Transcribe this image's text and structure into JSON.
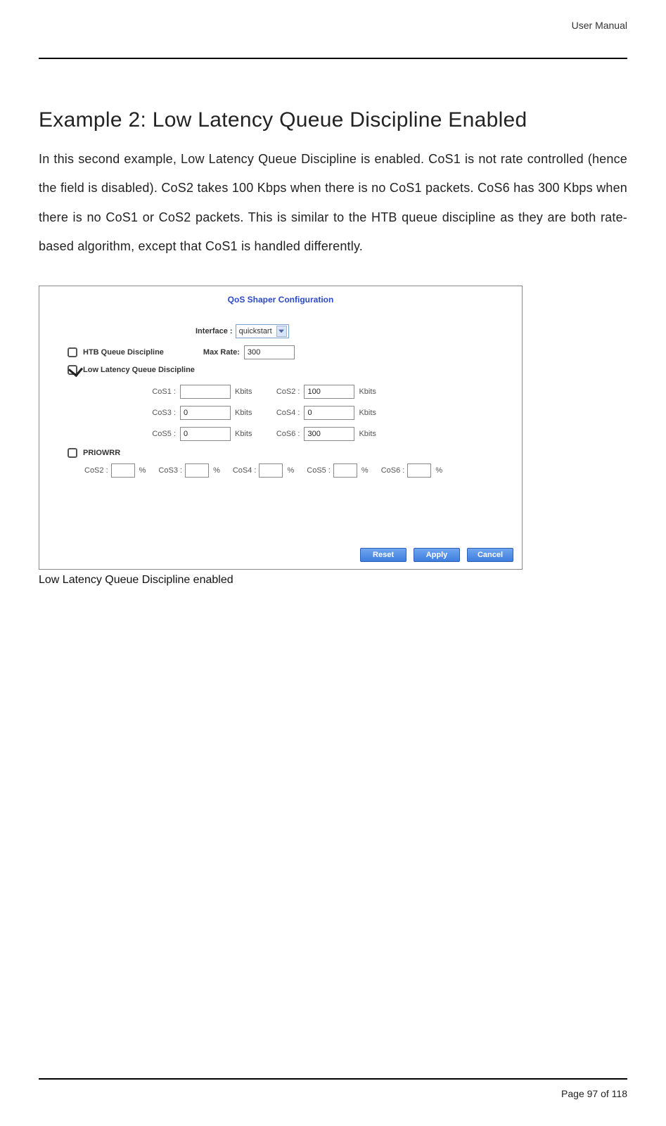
{
  "header": {
    "doc_title": "User Manual"
  },
  "section": {
    "title": "Example 2: Low Latency Queue Discipline Enabled",
    "body": "In this second example, Low Latency Queue Discipline is enabled. CoS1 is not rate controlled (hence the field is disabled). CoS2 takes 100 Kbps when there is no CoS1 packets. CoS6 has 300 Kbps when there is no CoS1 or CoS2 packets. This is similar to the HTB queue discipline as they are both rate-based algorithm, except that CoS1 is handled differently."
  },
  "figure": {
    "title": "QoS Shaper Configuration",
    "interface_label": "Interface :",
    "interface_value": "quickstart",
    "htb_label": "HTB Queue Discipline",
    "htb_checked": false,
    "maxrate_label": "Max Rate:",
    "maxrate_value": "300",
    "ll_label": "Low Latency Queue Discipline",
    "ll_checked": true,
    "cos_unit": "Kbits",
    "cos": [
      {
        "label": "CoS1 :",
        "value": ""
      },
      {
        "label": "CoS2 :",
        "value": "100"
      },
      {
        "label": "CoS3 :",
        "value": "0"
      },
      {
        "label": "CoS4 :",
        "value": "0"
      },
      {
        "label": "CoS5 :",
        "value": "0"
      },
      {
        "label": "CoS6 :",
        "value": "300"
      }
    ],
    "priowrr_label": "PRIOWRR",
    "priowrr_checked": false,
    "prio_unit": "%",
    "prio": [
      {
        "label": "CoS2 :",
        "value": ""
      },
      {
        "label": "CoS3 :",
        "value": ""
      },
      {
        "label": "CoS4 :",
        "value": ""
      },
      {
        "label": "CoS5 :",
        "value": ""
      },
      {
        "label": "CoS6 :",
        "value": ""
      }
    ],
    "buttons": {
      "reset": "Reset",
      "apply": "Apply",
      "cancel": "Cancel"
    },
    "caption": "Low Latency Queue Discipline enabled"
  },
  "footer": {
    "page_label_prefix": "Page ",
    "page_current": "97",
    "page_label_mid": " of ",
    "page_total": "118"
  }
}
